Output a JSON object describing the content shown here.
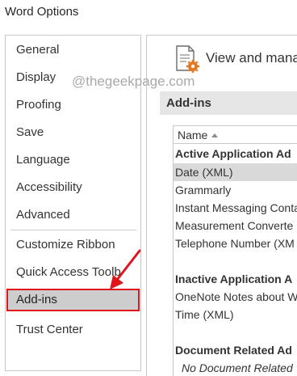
{
  "window": {
    "title": "Word Options"
  },
  "sidebar": {
    "items": [
      {
        "label": "General"
      },
      {
        "label": "Display"
      },
      {
        "label": "Proofing"
      },
      {
        "label": "Save"
      },
      {
        "label": "Language"
      },
      {
        "label": "Accessibility"
      },
      {
        "label": "Advanced"
      },
      {
        "label": "Customize Ribbon"
      },
      {
        "label": "Quick Access Toolb"
      },
      {
        "label": "Add-ins",
        "selected": true
      },
      {
        "label": "Trust Center"
      }
    ]
  },
  "main": {
    "header_title": "View and mana",
    "watermark": "@thegeekpage.com",
    "section_title": "Add-ins",
    "list": {
      "column_header": "Name",
      "rows": [
        {
          "text": "Active Application Ad",
          "kind": "group"
        },
        {
          "text": "Date (XML)",
          "kind": "item",
          "selected": true
        },
        {
          "text": "Grammarly",
          "kind": "item"
        },
        {
          "text": "Instant Messaging Conta",
          "kind": "item"
        },
        {
          "text": "Measurement Converte",
          "kind": "item"
        },
        {
          "text": "Telephone Number (XM",
          "kind": "item"
        },
        {
          "text": "Inactive Application A",
          "kind": "group"
        },
        {
          "text": "OneNote Notes about W",
          "kind": "item"
        },
        {
          "text": "Time (XML)",
          "kind": "item"
        },
        {
          "text": "Document Related Ad",
          "kind": "group"
        },
        {
          "text": "No Document Related",
          "kind": "empty"
        }
      ]
    }
  },
  "colors": {
    "highlight_border": "#e0141b",
    "selected_bg": "#cdcdcd",
    "section_bar_bg": "#e6e6e6",
    "gear_icon": "#e8741e"
  },
  "icons": {
    "header": "document-gear-icon",
    "sort": "sort-ascending-icon",
    "annotation": "red-arrow-icon"
  }
}
